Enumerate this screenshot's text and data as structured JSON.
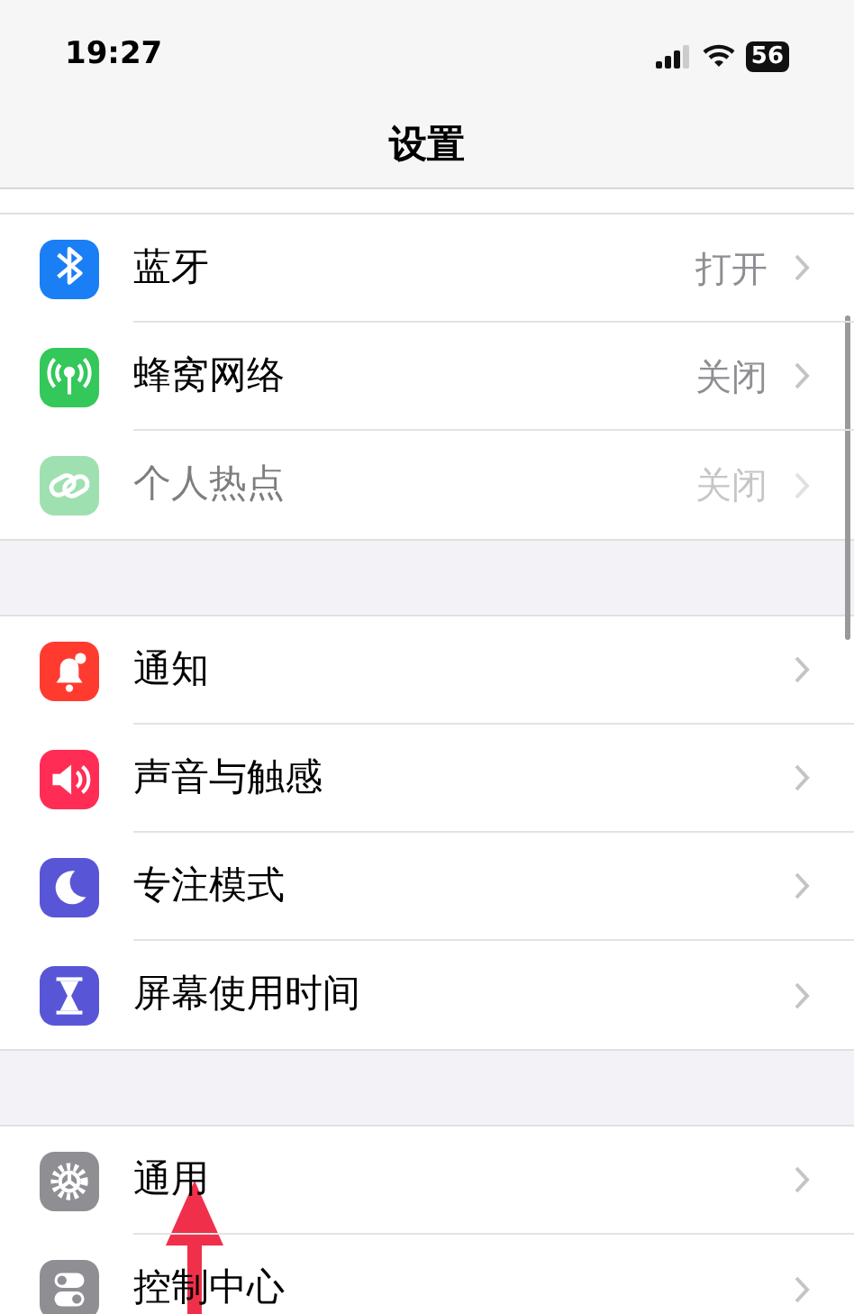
{
  "status_bar": {
    "time": "19:27",
    "battery": "56"
  },
  "nav_bar": {
    "title": "设置"
  },
  "sections": [
    {
      "rows": [
        {
          "label": "蓝牙",
          "value": "打开",
          "kind": "bluetooth",
          "color": "#1a7ef5",
          "disabled": false
        },
        {
          "label": "蜂窝网络",
          "value": "关闭",
          "kind": "antenna",
          "color": "#34c759",
          "disabled": false
        },
        {
          "label": "个人热点",
          "value": "关闭",
          "kind": "link",
          "color": "#9fe0b0",
          "disabled": true
        }
      ]
    },
    {
      "rows": [
        {
          "label": "通知",
          "kind": "bell",
          "color": "#ff3b30",
          "disabled": false
        },
        {
          "label": "声音与触感",
          "kind": "speaker",
          "color": "#ff2d55",
          "disabled": false
        },
        {
          "label": "专注模式",
          "kind": "moon",
          "color": "#5856d6",
          "disabled": false
        },
        {
          "label": "屏幕使用时间",
          "kind": "hourglass",
          "color": "#5856d6",
          "disabled": false
        }
      ]
    },
    {
      "rows": [
        {
          "label": "通用",
          "kind": "gear",
          "color": "#8e8e93",
          "disabled": false
        },
        {
          "label": "控制中心",
          "kind": "toggles",
          "color": "#8e8e93",
          "disabled": false
        }
      ]
    }
  ]
}
